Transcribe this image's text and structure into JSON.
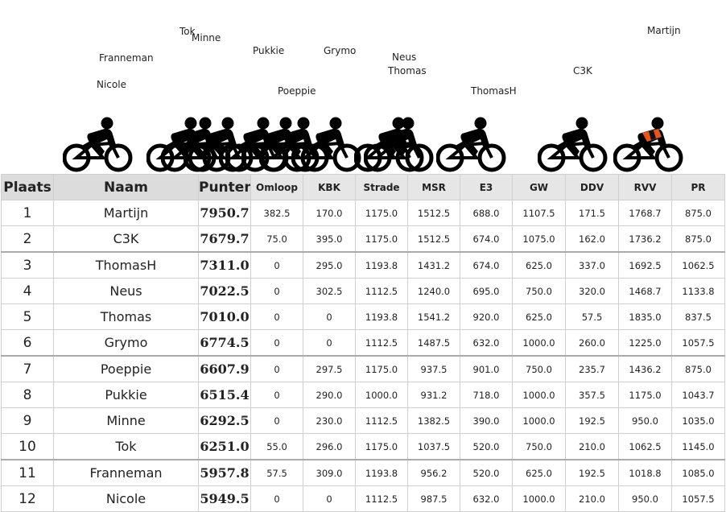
{
  "race": {
    "riders": [
      {
        "name": "Tok"
      },
      {
        "name": "Minne"
      },
      {
        "name": "Franneman"
      },
      {
        "name": "Nicole"
      },
      {
        "name": "Pukkie"
      },
      {
        "name": "Grymo"
      },
      {
        "name": "Poeppie"
      },
      {
        "name": "Neus"
      },
      {
        "name": "Thomas"
      },
      {
        "name": "ThomasH"
      },
      {
        "name": "C3K"
      },
      {
        "name": "Martijn"
      }
    ],
    "leader_jersey_colors": [
      "#e8541c",
      "#111111"
    ]
  },
  "table": {
    "headers": {
      "place": "Plaats",
      "name": "Naam",
      "points": "Punten",
      "omloop": "Omloop",
      "kbk": "KBK",
      "strade": "Strade",
      "msr": "MSR",
      "e3": "E3",
      "gw": "GW",
      "ddv": "DDV",
      "rvv": "RVV",
      "pr": "PR"
    },
    "rows": [
      {
        "place": "1",
        "name": "Martijn",
        "points": "7950.7",
        "omloop": "382.5",
        "kbk": "170.0",
        "strade": "1175.0",
        "msr": "1512.5",
        "e3": "688.0",
        "gw": "1107.5",
        "ddv": "171.5",
        "rvv": "1768.7",
        "pr": "875.0"
      },
      {
        "place": "2",
        "name": "C3K",
        "points": "7679.7",
        "omloop": "75.0",
        "kbk": "395.0",
        "strade": "1175.0",
        "msr": "1512.5",
        "e3": "674.0",
        "gw": "1075.0",
        "ddv": "162.0",
        "rvv": "1736.2",
        "pr": "875.0"
      },
      {
        "place": "3",
        "name": "ThomasH",
        "points": "7311.0",
        "omloop": "0",
        "kbk": "295.0",
        "strade": "1193.8",
        "msr": "1431.2",
        "e3": "674.0",
        "gw": "625.0",
        "ddv": "337.0",
        "rvv": "1692.5",
        "pr": "1062.5"
      },
      {
        "place": "4",
        "name": "Neus",
        "points": "7022.5",
        "omloop": "0",
        "kbk": "302.5",
        "strade": "1112.5",
        "msr": "1240.0",
        "e3": "695.0",
        "gw": "750.0",
        "ddv": "320.0",
        "rvv": "1468.7",
        "pr": "1133.8"
      },
      {
        "place": "5",
        "name": "Thomas",
        "points": "7010.0",
        "omloop": "0",
        "kbk": "0",
        "strade": "1193.8",
        "msr": "1541.2",
        "e3": "920.0",
        "gw": "625.0",
        "ddv": "57.5",
        "rvv": "1835.0",
        "pr": "837.5"
      },
      {
        "place": "6",
        "name": "Grymo",
        "points": "6774.5",
        "omloop": "0",
        "kbk": "0",
        "strade": "1112.5",
        "msr": "1487.5",
        "e3": "632.0",
        "gw": "1000.0",
        "ddv": "260.0",
        "rvv": "1225.0",
        "pr": "1057.5"
      },
      {
        "place": "7",
        "name": "Poeppie",
        "points": "6607.9",
        "omloop": "0",
        "kbk": "297.5",
        "strade": "1175.0",
        "msr": "937.5",
        "e3": "901.0",
        "gw": "750.0",
        "ddv": "235.7",
        "rvv": "1436.2",
        "pr": "875.0"
      },
      {
        "place": "8",
        "name": "Pukkie",
        "points": "6515.4",
        "omloop": "0",
        "kbk": "290.0",
        "strade": "1000.0",
        "msr": "931.2",
        "e3": "718.0",
        "gw": "1000.0",
        "ddv": "357.5",
        "rvv": "1175.0",
        "pr": "1043.7"
      },
      {
        "place": "9",
        "name": "Minne",
        "points": "6292.5",
        "omloop": "0",
        "kbk": "230.0",
        "strade": "1112.5",
        "msr": "1382.5",
        "e3": "390.0",
        "gw": "1000.0",
        "ddv": "192.5",
        "rvv": "950.0",
        "pr": "1035.0"
      },
      {
        "place": "10",
        "name": "Tok",
        "points": "6251.0",
        "omloop": "55.0",
        "kbk": "296.0",
        "strade": "1175.0",
        "msr": "1037.5",
        "e3": "520.0",
        "gw": "750.0",
        "ddv": "210.0",
        "rvv": "1062.5",
        "pr": "1145.0"
      },
      {
        "place": "11",
        "name": "Franneman",
        "points": "5957.8",
        "omloop": "57.5",
        "kbk": "309.0",
        "strade": "1193.8",
        "msr": "956.2",
        "e3": "520.0",
        "gw": "625.0",
        "ddv": "192.5",
        "rvv": "1018.8",
        "pr": "1085.0"
      },
      {
        "place": "12",
        "name": "Nicole",
        "points": "5949.5",
        "omloop": "0",
        "kbk": "0",
        "strade": "1112.5",
        "msr": "987.5",
        "e3": "632.0",
        "gw": "1000.0",
        "ddv": "210.0",
        "rvv": "950.0",
        "pr": "1057.5"
      }
    ]
  }
}
